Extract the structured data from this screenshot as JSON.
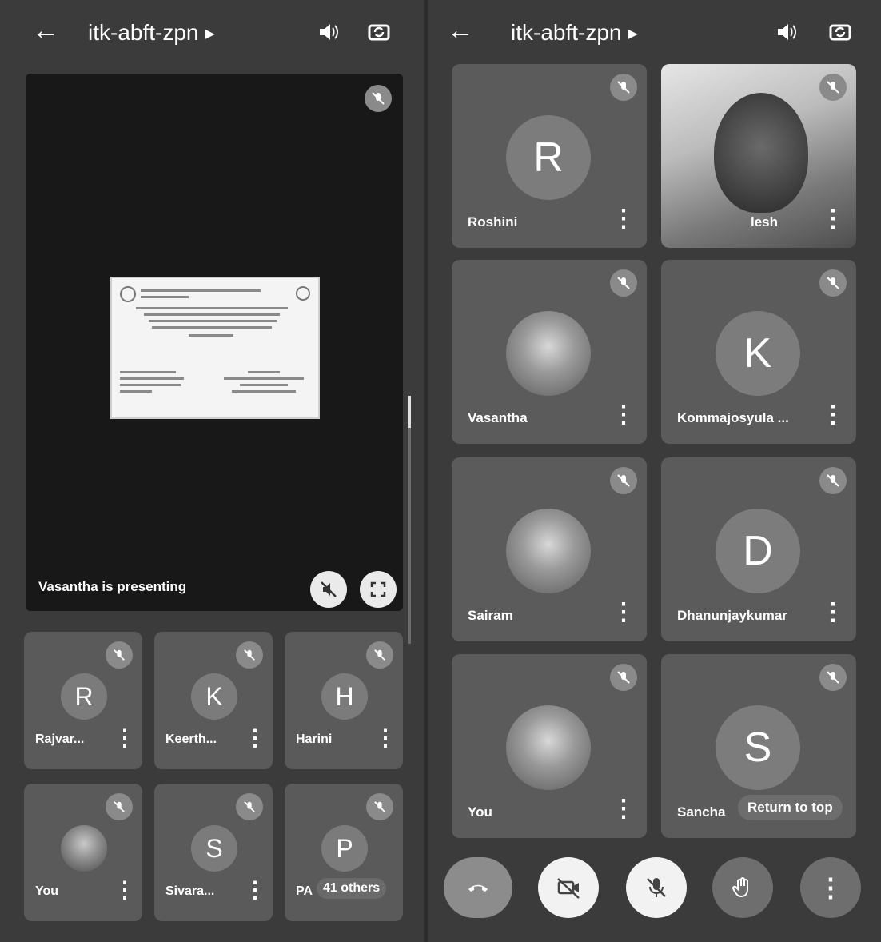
{
  "meeting": {
    "code": "itk-abft-zpn"
  },
  "left_pane": {
    "presenting_label": "Vasantha is presenting",
    "tiles": [
      {
        "name": "Rajvar...",
        "initial": "R",
        "photo": false
      },
      {
        "name": "Keerth...",
        "initial": "K",
        "photo": false
      },
      {
        "name": "Harini",
        "initial": "H",
        "photo": false
      },
      {
        "name": "You",
        "initial": "",
        "photo": true
      },
      {
        "name": "Sivara...",
        "initial": "S",
        "photo": false
      },
      {
        "name": "PA",
        "initial": "P",
        "photo": false,
        "others": "41 others"
      }
    ]
  },
  "right_pane": {
    "tiles": [
      {
        "name": "Roshini",
        "initial": "R",
        "photo": false
      },
      {
        "name": "lesh",
        "initial": "",
        "video": true
      },
      {
        "name": "Vasantha",
        "initial": "",
        "photo": true
      },
      {
        "name": "Kommajosyula ...",
        "initial": "K",
        "photo": false
      },
      {
        "name": "Sairam",
        "initial": "",
        "photo": true
      },
      {
        "name": "Dhanunjaykumar",
        "initial": "D",
        "photo": false
      },
      {
        "name": "You",
        "initial": "",
        "photo": true
      },
      {
        "name": "Sancha",
        "initial": "S",
        "photo": false
      }
    ],
    "return_to_top": "Return to top"
  },
  "icons": {
    "back": "arrow-left-icon",
    "speaker": "speaker-icon",
    "switch_camera": "switch-camera-icon",
    "mic_off": "mic-off-icon",
    "more": "more-vert-icon",
    "end_call": "end-call-icon",
    "camera_off": "camera-off-icon",
    "raise_hand": "raise-hand-icon",
    "fullscreen": "fullscreen-icon"
  },
  "colors": {
    "background": "#3b3b3b",
    "tile": "#5b5b5b",
    "end_call": "#8c8c8c"
  }
}
